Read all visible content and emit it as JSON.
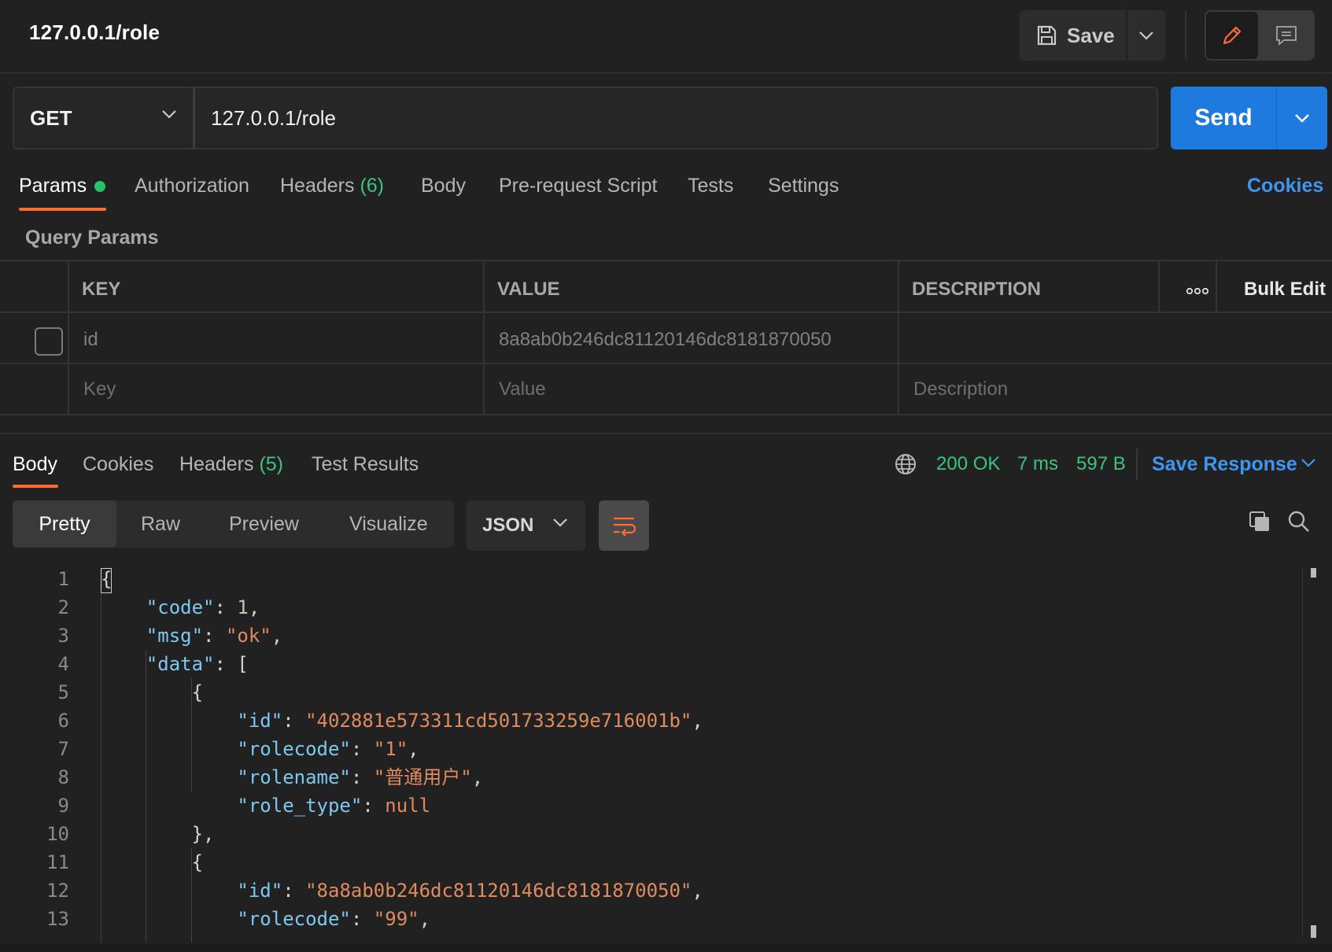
{
  "header": {
    "title": "127.0.0.1/role",
    "save_label": "Save"
  },
  "request": {
    "method": "GET",
    "url": "127.0.0.1/role",
    "send_label": "Send"
  },
  "request_tabs": {
    "params": "Params",
    "authorization": "Authorization",
    "headers": "Headers",
    "headers_count": "(6)",
    "body": "Body",
    "pre_request": "Pre-request Script",
    "tests": "Tests",
    "settings": "Settings",
    "cookies": "Cookies"
  },
  "query_params": {
    "title": "Query Params",
    "columns": {
      "key": "KEY",
      "value": "VALUE",
      "description": "DESCRIPTION"
    },
    "bulk_edit": "Bulk Edit",
    "rows": [
      {
        "key": "id",
        "value": "8a8ab0b246dc81120146dc8181870050",
        "description": ""
      }
    ],
    "placeholder": {
      "key": "Key",
      "value": "Value",
      "description": "Description"
    }
  },
  "response_tabs": {
    "body": "Body",
    "cookies": "Cookies",
    "headers": "Headers",
    "headers_count": "(5)",
    "test_results": "Test Results"
  },
  "response_status": {
    "code": "200 OK",
    "time": "7 ms",
    "size": "597 B",
    "save_response": "Save Response"
  },
  "view_modes": {
    "pretty": "Pretty",
    "raw": "Raw",
    "preview": "Preview",
    "visualize": "Visualize",
    "format": "JSON"
  },
  "code_lines": [
    "1",
    "2",
    "3",
    "4",
    "5",
    "6",
    "7",
    "8",
    "9",
    "10",
    "11",
    "12",
    "13"
  ],
  "response_body": {
    "code": "1",
    "msg": "\"ok\"",
    "item1": {
      "id": "\"402881e573311cd501733259e716001b\"",
      "rolecode": "\"1\"",
      "rolename": "\"普通用户\"",
      "role_type": "null"
    },
    "item2": {
      "id": "\"8a8ab0b246dc81120146dc8181870050\"",
      "rolecode": "\"99\""
    }
  },
  "colors": {
    "accent_send": "#1f7ae0",
    "tab_underline": "#ff6b35",
    "status_ok": "#3fc281",
    "link": "#3f96f0"
  }
}
